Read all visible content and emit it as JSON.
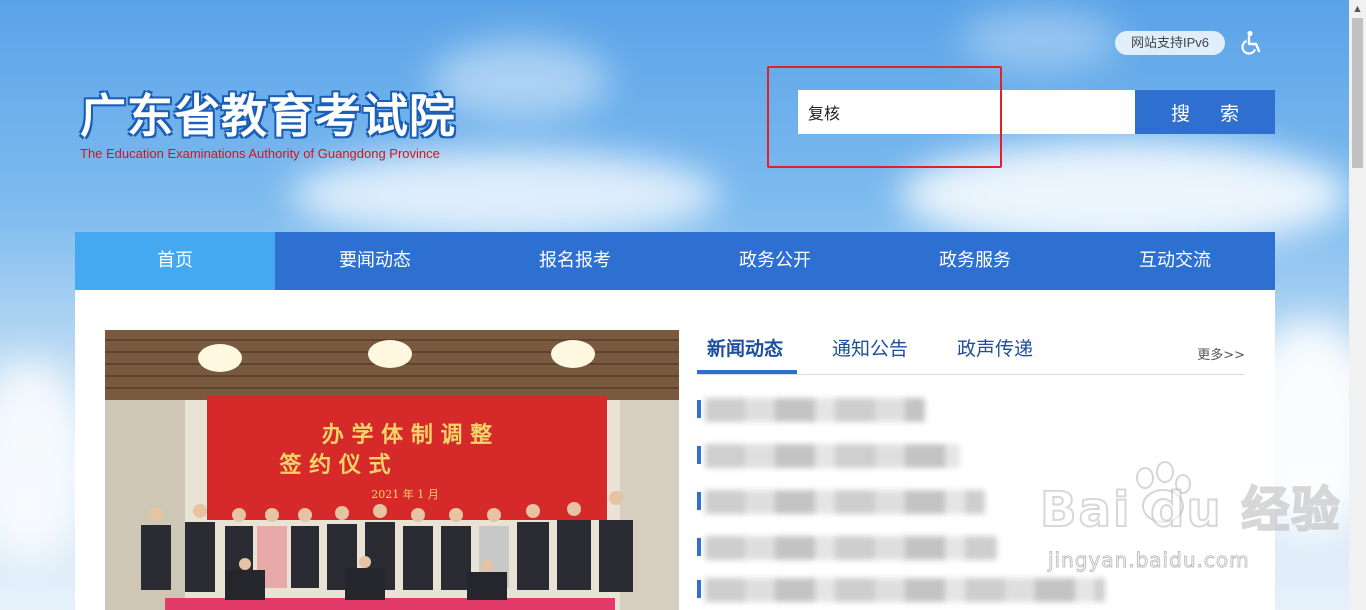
{
  "header": {
    "logo_cn": "广东省教育考试院",
    "logo_en": "The Education Examinations Authority of Guangdong Province",
    "ipv6_badge": "网站支持IPv6",
    "accessibility_icon": "wheelchair-icon"
  },
  "search": {
    "value": "复核",
    "button_label": "搜 索"
  },
  "nav": {
    "items": [
      "首页",
      "要闻动态",
      "报名报考",
      "政务公开",
      "政务服务",
      "互动交流"
    ],
    "active_index": 0
  },
  "photo": {
    "banner_line1": "办 学 体 制 调 整",
    "banner_line2": "签 约 仪 式",
    "banner_date": "2021 年 1 月"
  },
  "news": {
    "tabs": [
      "新闻动态",
      "通知公告",
      "政声传递"
    ],
    "active_tab": 0,
    "more_label": "更多>>"
  },
  "watermark": {
    "brand": "Bai du 经验",
    "url": "jingyan.baidu.com"
  },
  "colors": {
    "nav_bg": "#2e6fd2",
    "nav_active": "#45a9f2",
    "search_button": "#2f6fcf",
    "highlight_box": "#e0202a",
    "logo_en": "#d4141c"
  }
}
